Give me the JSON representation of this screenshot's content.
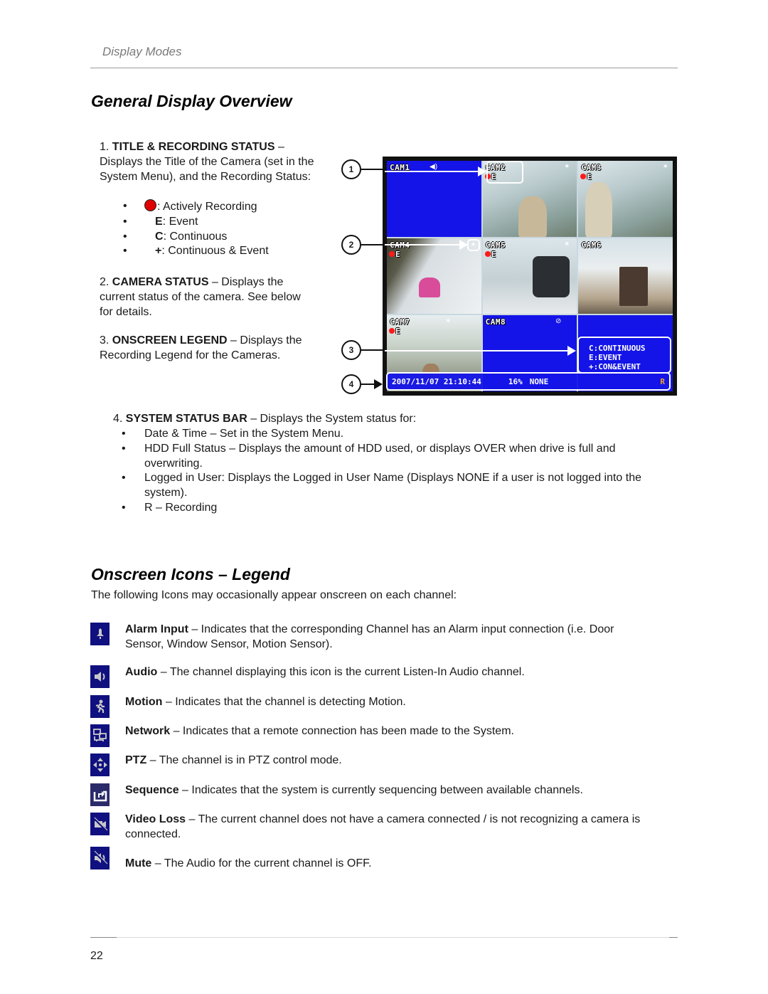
{
  "header": {
    "section": "Display Modes"
  },
  "section1": {
    "title": "General Display Overview",
    "items": [
      {
        "num": "1.",
        "label": "TITLE & RECORDING STATUS",
        "dash": " –",
        "text": "Displays the Title of the Camera (set in the System Menu), and the Recording Status:"
      },
      {
        "num": "2.",
        "label": "CAMERA STATUS",
        "dash": " – ",
        "text": "Displays the current status of the camera. See below for details."
      },
      {
        "num": "3.",
        "label": "ONSCREEN LEGEND",
        "dash": " – ",
        "text": "Displays the Recording Legend for the Cameras."
      }
    ],
    "recording_legend": [
      {
        "symbol": "",
        "symbol_type": "red-dot",
        "text": ": Actively Recording"
      },
      {
        "symbol": "E",
        "text": ": Event"
      },
      {
        "symbol": "C",
        "text": ": Continuous"
      },
      {
        "symbol": "+",
        "text": ": Continuous & Event"
      }
    ],
    "bullet_char": "•"
  },
  "callouts": [
    "1",
    "2",
    "3",
    "4"
  ],
  "dvr_screen": {
    "tiles": [
      {
        "label": "CAM1",
        "status": "",
        "icon": "audio-icon",
        "icon_glyph": "◀)",
        "feed": false
      },
      {
        "label": "CAM2",
        "status": "E",
        "recording": true,
        "icon": "motion-icon",
        "icon_glyph": "🏃︎",
        "feed": true
      },
      {
        "label": "CAM3",
        "status": "E",
        "recording": true,
        "icon": "motion-icon",
        "icon_glyph": "🏃︎",
        "feed": true
      },
      {
        "label": "CAM4",
        "status": "E",
        "recording": true,
        "icon": "motion-icon",
        "icon_glyph": "🏃︎",
        "feed": true
      },
      {
        "label": "CAM5",
        "status": "E",
        "recording": true,
        "icon": "motion-icon",
        "icon_glyph": "🏃︎",
        "feed": true
      },
      {
        "label": "CAM6",
        "status": "",
        "icon": "",
        "icon_glyph": "",
        "feed": true
      },
      {
        "label": "CAM7",
        "status": "E",
        "recording": true,
        "icon": "motion-icon",
        "icon_glyph": "🏃︎",
        "feed": true
      },
      {
        "label": "CAM8",
        "status": "",
        "icon": "video-loss-icon",
        "icon_glyph": "⊘",
        "feed": false
      },
      {
        "label": "",
        "status": "",
        "icon": "",
        "icon_glyph": "",
        "feed": false
      }
    ],
    "legend": [
      "C:CONTINUOUS",
      "E:EVENT",
      "+:CON&EVENT"
    ],
    "status_bar": {
      "datetime": "2007/11/07 21:10:44",
      "hdd": "16%",
      "user": "NONE",
      "recording_flag": "R"
    }
  },
  "system_status": {
    "num": "4.",
    "label": "SYSTEM STATUS BAR",
    "text": " – Displays the System status for:",
    "bullets": [
      "Date & Time – Set in the System Menu.",
      "HDD Full Status – Displays the amount of HDD used, or displays OVER when drive is full and overwriting.",
      "Logged in User: Displays the Logged in User Name (Displays NONE if a user is not logged into the system).",
      "R – Recording"
    ]
  },
  "section2": {
    "title": "Onscreen Icons – Legend",
    "intro": "The following Icons may occasionally appear onscreen on each channel:",
    "icons": [
      {
        "icon": "alarm-input-icon",
        "name": "Alarm Input",
        "text": " – Indicates that the corresponding Channel has an Alarm input connection (i.e. Door Sensor, Window Sensor, Motion Sensor)."
      },
      {
        "icon": "audio-icon",
        "name": "Audio",
        "text": " – The channel displaying this icon is the current Listen-In Audio channel."
      },
      {
        "icon": "motion-icon",
        "name": "Motion",
        "text": " – Indicates that the channel is detecting Motion."
      },
      {
        "icon": "network-icon",
        "name": "Network",
        "text": " – Indicates that a remote connection has been made to the System."
      },
      {
        "icon": "ptz-icon",
        "name": "PTZ",
        "text": " – The channel is in PTZ control mode."
      },
      {
        "icon": "sequence-icon",
        "name": "Sequence",
        "text": " – Indicates that the system is currently sequencing between available channels."
      },
      {
        "icon": "video-loss-icon",
        "name": "Video Loss",
        "text": " – The current channel does not have a camera connected / is not recognizing a camera is connected."
      },
      {
        "icon": "mute-icon",
        "name": "Mute",
        "text": " – The Audio for the current channel is OFF."
      }
    ]
  },
  "footer": {
    "page_number": "22"
  }
}
